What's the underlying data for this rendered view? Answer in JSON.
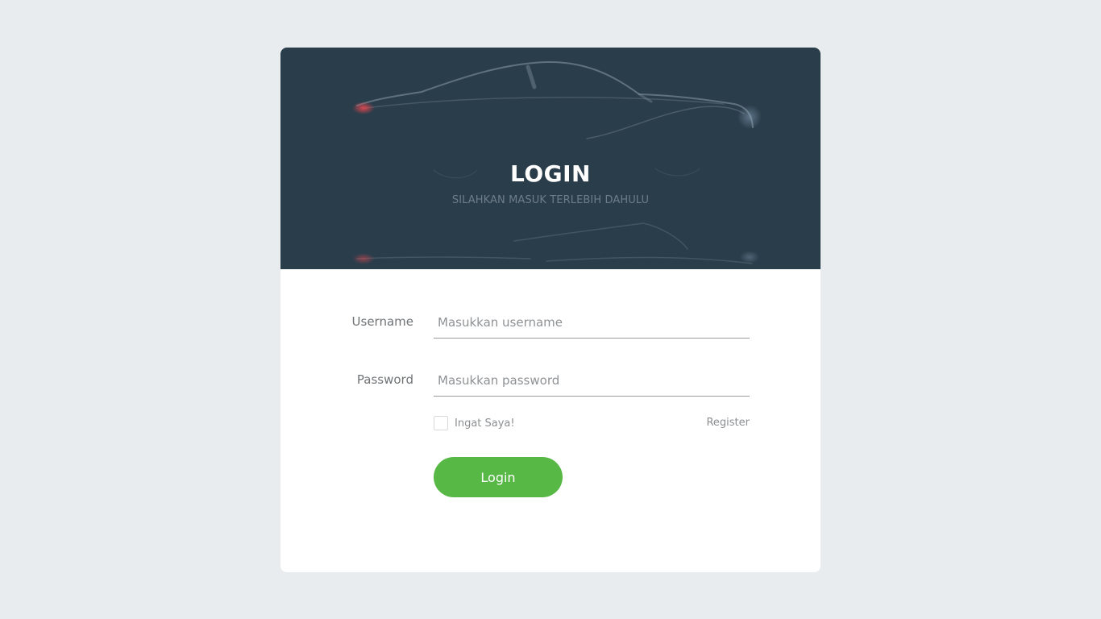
{
  "header": {
    "title": "LOGIN",
    "subtitle": "SILAHKAN MASUK TERLEBIH DAHULU"
  },
  "form": {
    "username": {
      "label": "Username",
      "placeholder": "Masukkan username",
      "value": ""
    },
    "password": {
      "label": "Password",
      "placeholder": "Masukkan password",
      "value": ""
    },
    "remember": {
      "label": "Ingat Saya!",
      "checked": false
    },
    "register_label": "Register",
    "login_label": "Login"
  },
  "colors": {
    "background": "#e9ecee",
    "hero": "#2a3d4b",
    "button": "#57b846"
  },
  "icons": {
    "hero_background": "car-silhouette"
  }
}
